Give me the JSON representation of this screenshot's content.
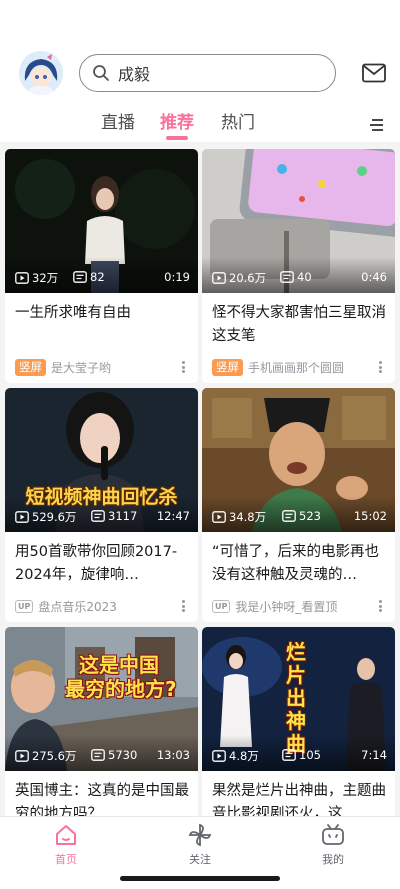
{
  "header": {
    "search_placeholder": "成毅",
    "tabs": [
      {
        "label": "直播",
        "active": false
      },
      {
        "label": "推荐",
        "active": true
      },
      {
        "label": "热门",
        "active": false
      }
    ]
  },
  "feed": [
    {
      "views": "32万",
      "comments": "82",
      "duration": "0:19",
      "title": "一生所求唯有自由",
      "badge": "竖屏",
      "author": "是大莹子哟"
    },
    {
      "views": "20.6万",
      "comments": "40",
      "duration": "0:46",
      "title": "怪不得大家都害怕三星取消这支笔",
      "badge": "竖屏",
      "author": "手机画画那个圆圆"
    },
    {
      "views": "529.6万",
      "comments": "3117",
      "duration": "12:47",
      "title": "用50首歌带你回顾2017-2024年，旋律响…",
      "badge": "UP",
      "author": "盘点音乐2023",
      "overlay": "短视频神曲回忆杀"
    },
    {
      "views": "34.8万",
      "comments": "523",
      "duration": "15:02",
      "title": "“可惜了，后来的电影再也没有这种触及灵魂的…",
      "badge": "UP",
      "author": "我是小钟呀_看置顶"
    },
    {
      "views": "275.6万",
      "comments": "5730",
      "duration": "13:03",
      "title": "英国博主：这真的是中国最穷的地方吗？",
      "overlay_line1": "这是中国",
      "overlay_line2": "最穷的地方?"
    },
    {
      "views": "4.8万",
      "comments": "105",
      "duration": "7:14",
      "title": "果然是烂片出神曲，主题曲音比影视剧还火，这…",
      "overlay": "烂片出神曲"
    }
  ],
  "bottom_nav": [
    {
      "label": "首页",
      "icon": "home-icon",
      "active": true
    },
    {
      "label": "关注",
      "icon": "pinwheel-icon",
      "active": false
    },
    {
      "label": "我的",
      "icon": "tv-icon",
      "active": false
    }
  ],
  "colors": {
    "accent": "#fb7299",
    "vertical_badge": "#fb9b52",
    "meta_gray": "#9499a0"
  }
}
